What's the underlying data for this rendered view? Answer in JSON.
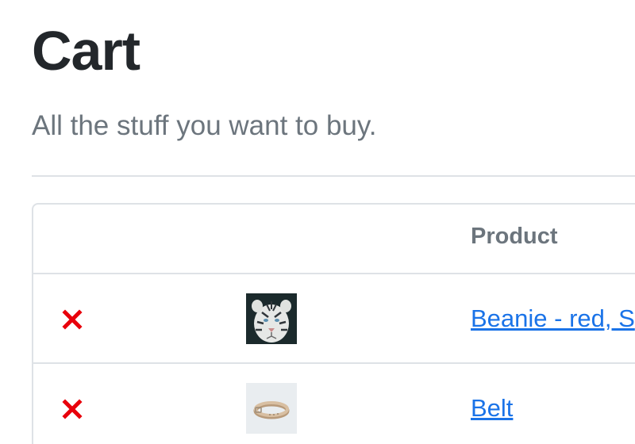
{
  "page": {
    "title": "Cart",
    "subtitle": "All the stuff you want to buy."
  },
  "table": {
    "columns": [
      "",
      "",
      "Product"
    ],
    "rows": [
      {
        "remove_icon": "close-icon",
        "thumbnail": "white-tiger-image",
        "product_name": "Beanie - red, S"
      },
      {
        "remove_icon": "close-icon",
        "thumbnail": "belt-image",
        "product_name": "Belt"
      }
    ]
  },
  "colors": {
    "remove_icon": "#e8000b",
    "link": "#1a73e8",
    "muted_text": "#6c757d",
    "border": "#dee2e6"
  }
}
